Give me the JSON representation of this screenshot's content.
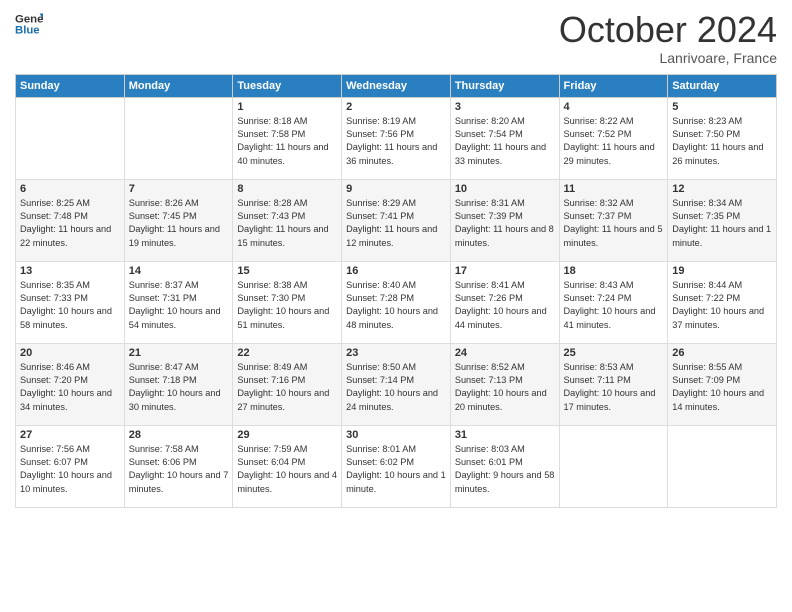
{
  "logo": {
    "text_general": "General",
    "text_blue": "Blue"
  },
  "header": {
    "month": "October 2024",
    "location": "Lanrivoare, France"
  },
  "days_of_week": [
    "Sunday",
    "Monday",
    "Tuesday",
    "Wednesday",
    "Thursday",
    "Friday",
    "Saturday"
  ],
  "weeks": [
    [
      {
        "day": "",
        "sunrise": "",
        "sunset": "",
        "daylight": ""
      },
      {
        "day": "",
        "sunrise": "",
        "sunset": "",
        "daylight": ""
      },
      {
        "day": "1",
        "sunrise": "Sunrise: 8:18 AM",
        "sunset": "Sunset: 7:58 PM",
        "daylight": "Daylight: 11 hours and 40 minutes."
      },
      {
        "day": "2",
        "sunrise": "Sunrise: 8:19 AM",
        "sunset": "Sunset: 7:56 PM",
        "daylight": "Daylight: 11 hours and 36 minutes."
      },
      {
        "day": "3",
        "sunrise": "Sunrise: 8:20 AM",
        "sunset": "Sunset: 7:54 PM",
        "daylight": "Daylight: 11 hours and 33 minutes."
      },
      {
        "day": "4",
        "sunrise": "Sunrise: 8:22 AM",
        "sunset": "Sunset: 7:52 PM",
        "daylight": "Daylight: 11 hours and 29 minutes."
      },
      {
        "day": "5",
        "sunrise": "Sunrise: 8:23 AM",
        "sunset": "Sunset: 7:50 PM",
        "daylight": "Daylight: 11 hours and 26 minutes."
      }
    ],
    [
      {
        "day": "6",
        "sunrise": "Sunrise: 8:25 AM",
        "sunset": "Sunset: 7:48 PM",
        "daylight": "Daylight: 11 hours and 22 minutes."
      },
      {
        "day": "7",
        "sunrise": "Sunrise: 8:26 AM",
        "sunset": "Sunset: 7:45 PM",
        "daylight": "Daylight: 11 hours and 19 minutes."
      },
      {
        "day": "8",
        "sunrise": "Sunrise: 8:28 AM",
        "sunset": "Sunset: 7:43 PM",
        "daylight": "Daylight: 11 hours and 15 minutes."
      },
      {
        "day": "9",
        "sunrise": "Sunrise: 8:29 AM",
        "sunset": "Sunset: 7:41 PM",
        "daylight": "Daylight: 11 hours and 12 minutes."
      },
      {
        "day": "10",
        "sunrise": "Sunrise: 8:31 AM",
        "sunset": "Sunset: 7:39 PM",
        "daylight": "Daylight: 11 hours and 8 minutes."
      },
      {
        "day": "11",
        "sunrise": "Sunrise: 8:32 AM",
        "sunset": "Sunset: 7:37 PM",
        "daylight": "Daylight: 11 hours and 5 minutes."
      },
      {
        "day": "12",
        "sunrise": "Sunrise: 8:34 AM",
        "sunset": "Sunset: 7:35 PM",
        "daylight": "Daylight: 11 hours and 1 minute."
      }
    ],
    [
      {
        "day": "13",
        "sunrise": "Sunrise: 8:35 AM",
        "sunset": "Sunset: 7:33 PM",
        "daylight": "Daylight: 10 hours and 58 minutes."
      },
      {
        "day": "14",
        "sunrise": "Sunrise: 8:37 AM",
        "sunset": "Sunset: 7:31 PM",
        "daylight": "Daylight: 10 hours and 54 minutes."
      },
      {
        "day": "15",
        "sunrise": "Sunrise: 8:38 AM",
        "sunset": "Sunset: 7:30 PM",
        "daylight": "Daylight: 10 hours and 51 minutes."
      },
      {
        "day": "16",
        "sunrise": "Sunrise: 8:40 AM",
        "sunset": "Sunset: 7:28 PM",
        "daylight": "Daylight: 10 hours and 48 minutes."
      },
      {
        "day": "17",
        "sunrise": "Sunrise: 8:41 AM",
        "sunset": "Sunset: 7:26 PM",
        "daylight": "Daylight: 10 hours and 44 minutes."
      },
      {
        "day": "18",
        "sunrise": "Sunrise: 8:43 AM",
        "sunset": "Sunset: 7:24 PM",
        "daylight": "Daylight: 10 hours and 41 minutes."
      },
      {
        "day": "19",
        "sunrise": "Sunrise: 8:44 AM",
        "sunset": "Sunset: 7:22 PM",
        "daylight": "Daylight: 10 hours and 37 minutes."
      }
    ],
    [
      {
        "day": "20",
        "sunrise": "Sunrise: 8:46 AM",
        "sunset": "Sunset: 7:20 PM",
        "daylight": "Daylight: 10 hours and 34 minutes."
      },
      {
        "day": "21",
        "sunrise": "Sunrise: 8:47 AM",
        "sunset": "Sunset: 7:18 PM",
        "daylight": "Daylight: 10 hours and 30 minutes."
      },
      {
        "day": "22",
        "sunrise": "Sunrise: 8:49 AM",
        "sunset": "Sunset: 7:16 PM",
        "daylight": "Daylight: 10 hours and 27 minutes."
      },
      {
        "day": "23",
        "sunrise": "Sunrise: 8:50 AM",
        "sunset": "Sunset: 7:14 PM",
        "daylight": "Daylight: 10 hours and 24 minutes."
      },
      {
        "day": "24",
        "sunrise": "Sunrise: 8:52 AM",
        "sunset": "Sunset: 7:13 PM",
        "daylight": "Daylight: 10 hours and 20 minutes."
      },
      {
        "day": "25",
        "sunrise": "Sunrise: 8:53 AM",
        "sunset": "Sunset: 7:11 PM",
        "daylight": "Daylight: 10 hours and 17 minutes."
      },
      {
        "day": "26",
        "sunrise": "Sunrise: 8:55 AM",
        "sunset": "Sunset: 7:09 PM",
        "daylight": "Daylight: 10 hours and 14 minutes."
      }
    ],
    [
      {
        "day": "27",
        "sunrise": "Sunrise: 7:56 AM",
        "sunset": "Sunset: 6:07 PM",
        "daylight": "Daylight: 10 hours and 10 minutes."
      },
      {
        "day": "28",
        "sunrise": "Sunrise: 7:58 AM",
        "sunset": "Sunset: 6:06 PM",
        "daylight": "Daylight: 10 hours and 7 minutes."
      },
      {
        "day": "29",
        "sunrise": "Sunrise: 7:59 AM",
        "sunset": "Sunset: 6:04 PM",
        "daylight": "Daylight: 10 hours and 4 minutes."
      },
      {
        "day": "30",
        "sunrise": "Sunrise: 8:01 AM",
        "sunset": "Sunset: 6:02 PM",
        "daylight": "Daylight: 10 hours and 1 minute."
      },
      {
        "day": "31",
        "sunrise": "Sunrise: 8:03 AM",
        "sunset": "Sunset: 6:01 PM",
        "daylight": "Daylight: 9 hours and 58 minutes."
      },
      {
        "day": "",
        "sunrise": "",
        "sunset": "",
        "daylight": ""
      },
      {
        "day": "",
        "sunrise": "",
        "sunset": "",
        "daylight": ""
      }
    ]
  ]
}
